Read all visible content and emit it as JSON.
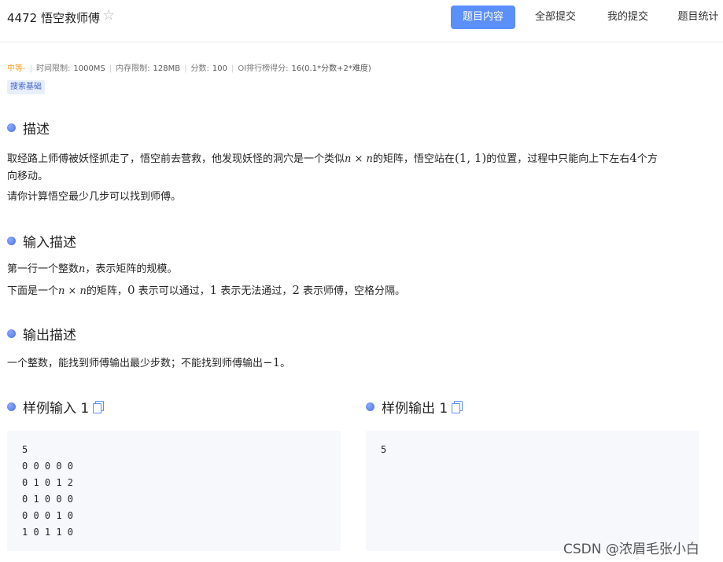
{
  "header": {
    "title": "4472 悟空救师傅",
    "tabs": [
      {
        "label": "题目内容",
        "active": true
      },
      {
        "label": "全部提交",
        "active": false
      },
      {
        "label": "我的提交",
        "active": false
      },
      {
        "label": "题目统计",
        "active": false
      }
    ]
  },
  "meta": {
    "difficulty": "中等-",
    "time_limit_label": "时间限制:",
    "time_limit": "1000MS",
    "memory_limit_label": "内存限制:",
    "memory_limit": "128MB",
    "score_label": "分数:",
    "score": "100",
    "oi_label": "OI排行榜得分:",
    "oi_value": "16(0.1*分数+2*难度)",
    "tag": "搜索基础"
  },
  "description": {
    "heading": "描述",
    "line1_a": "取经路上师傅被妖怪抓走了，悟空前去营救，他发现妖怪的洞穴是一个类似",
    "line1_math": "n × n",
    "line1_b": "的矩阵，悟空站在",
    "line1_math2": "(1, 1)",
    "line1_c": "的位置，过程中只能向上下左右",
    "line1_math3": "4",
    "line1_d": "个方",
    "line2": "向移动。",
    "line3": "请你计算悟空最少几步可以找到师傅。"
  },
  "input_desc": {
    "heading": "输入描述",
    "line1_a": "第一行一个整数",
    "line1_math": "n",
    "line1_b": "，表示矩阵的规模。",
    "line2_a": "下面是一个",
    "line2_math": "n × n",
    "line2_b": "的矩阵，",
    "line2_m0": "0",
    "line2_c": "表示可以通过，",
    "line2_m1": "1",
    "line2_d": "表示无法通过，",
    "line2_m2": "2",
    "line2_e": "表示师傅，空格分隔。"
  },
  "output_desc": {
    "heading": "输出描述",
    "line1_a": "一个整数，能找到师傅输出最少步数；不能找到师傅输出",
    "line1_math": "−1",
    "line1_b": "。"
  },
  "sample_input": {
    "heading": "样例输入 1",
    "lines": [
      "5",
      "0 0 0 0 0",
      "0 1 0 1 2",
      "0 1 0 0 0",
      "0 0 0 1 0",
      "1 0 1 1 0"
    ]
  },
  "sample_output": {
    "heading": "样例输出 1",
    "lines": [
      "5"
    ]
  },
  "watermark": "CSDN @浓眉毛张小白",
  "colors": {
    "accent": "#5b8ff9",
    "difficulty": "#f0a020",
    "code_bg": "#f6f8fc"
  },
  "icons": {
    "favorite": "star-outline-icon",
    "copy": "copy-icon",
    "bullet": "dot-icon"
  }
}
